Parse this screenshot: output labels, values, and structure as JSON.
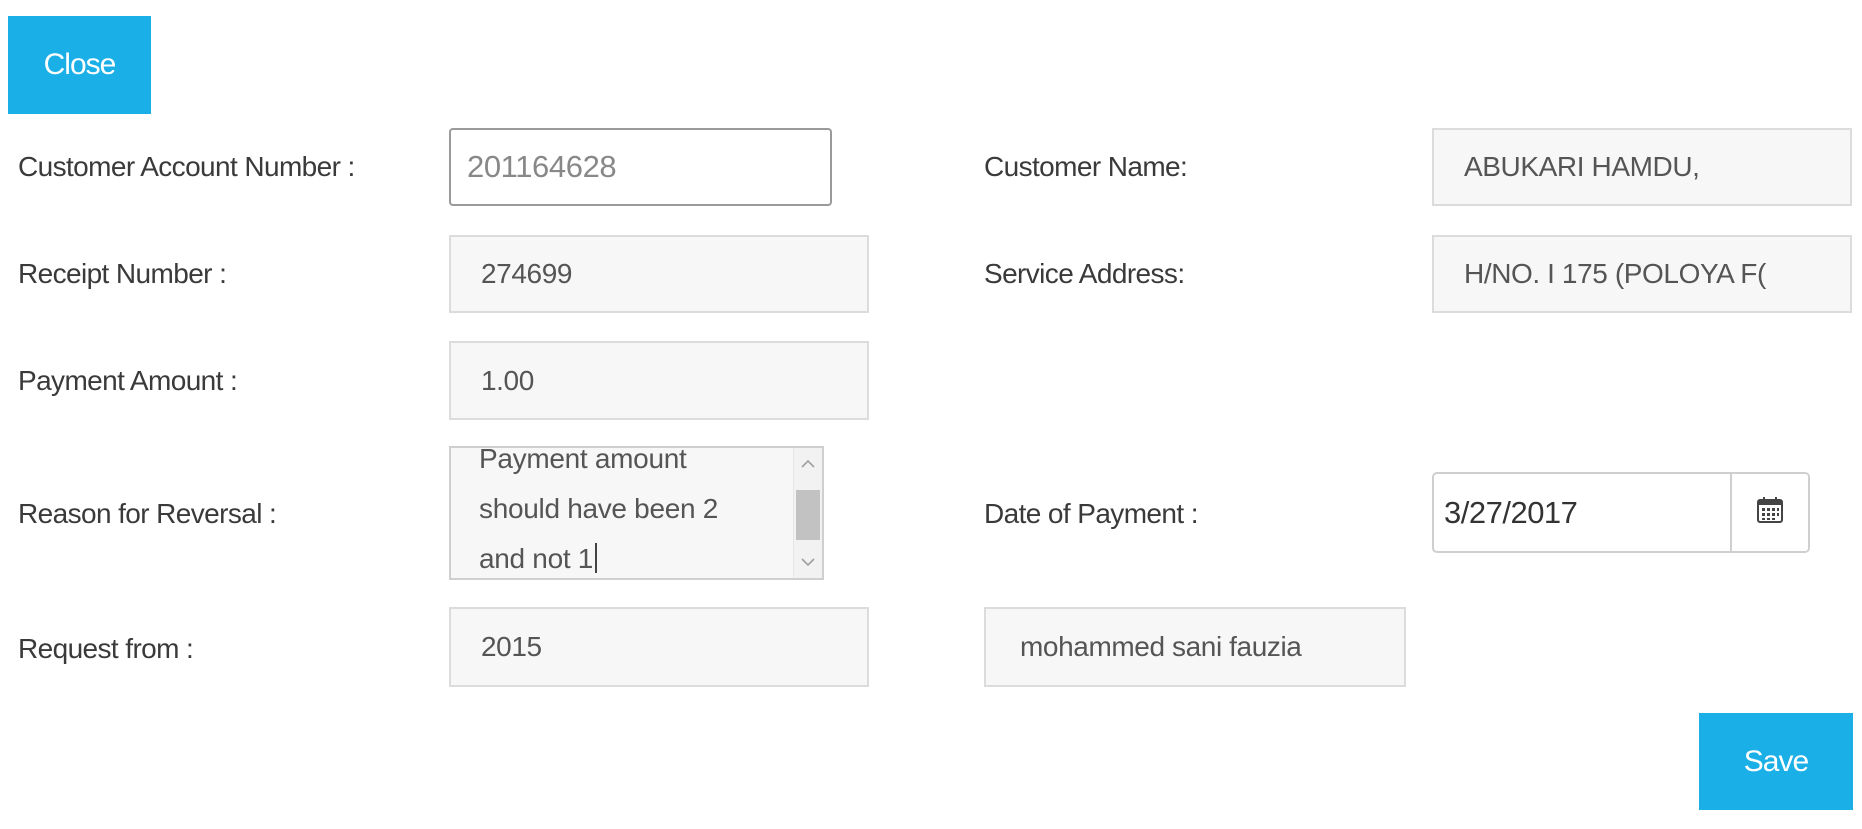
{
  "toolbar": {
    "close_label": "Close"
  },
  "form": {
    "account_number": {
      "label": "Customer Account Number :",
      "value": "201164628"
    },
    "customer_name": {
      "label": "Customer Name:",
      "value": "ABUKARI HAMDU,"
    },
    "receipt_number": {
      "label": "Receipt Number :",
      "value": "274699"
    },
    "service_address": {
      "label": "Service Address:",
      "value": "H/NO. I 175 (POLOYA F("
    },
    "payment_amount": {
      "label": "Payment Amount :",
      "value": "1.00"
    },
    "reason": {
      "label": "Reason for Reversal :",
      "value": "Payment amount should have been 2 and not 1"
    },
    "date_of_payment": {
      "label": "Date of Payment :",
      "value": "3/27/2017",
      "icon": "calendar-icon"
    },
    "request_from": {
      "label": "Request from :",
      "id_value": "2015",
      "name_value": "mohammed sani fauzia"
    }
  },
  "actions": {
    "save_label": "Save"
  },
  "colors": {
    "accent": "#1aafe6",
    "field_bg": "#f7f7f7",
    "field_border": "#dcdcdc"
  }
}
